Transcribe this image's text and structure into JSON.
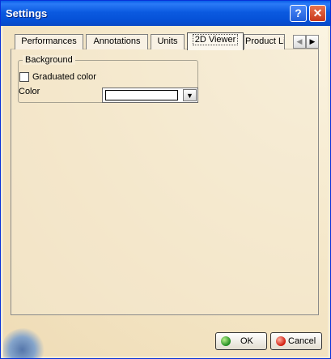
{
  "window": {
    "title": "Settings"
  },
  "titlebar": {
    "help_glyph": "?",
    "close_glyph": "✕"
  },
  "tabs": [
    {
      "label": "Performances",
      "active": false
    },
    {
      "label": "Annotations",
      "active": false
    },
    {
      "label": "Units",
      "active": false
    },
    {
      "label": "2D Viewer",
      "active": true
    },
    {
      "label": "Product Li",
      "active": false
    }
  ],
  "tab_scroll": {
    "left_glyph": "◀",
    "right_glyph": "▶"
  },
  "background_group": {
    "title": "Background",
    "graduated_color_label": "Graduated color",
    "graduated_color_checked": false,
    "color_label": "Color",
    "color_value": "#ffffff",
    "dropdown_glyph": "▼"
  },
  "buttons": {
    "ok": "OK",
    "cancel": "Cancel"
  },
  "icons": {
    "help": "help-icon",
    "close": "close-icon",
    "ok": "green-dot-icon",
    "cancel": "red-dot-icon",
    "decoration": "globe-icon"
  },
  "colors": {
    "titlebar": "#0550d6",
    "dialog": "#f4ead5",
    "ok_dot": "#1f8b1f",
    "cancel_dot": "#d11a0c"
  }
}
